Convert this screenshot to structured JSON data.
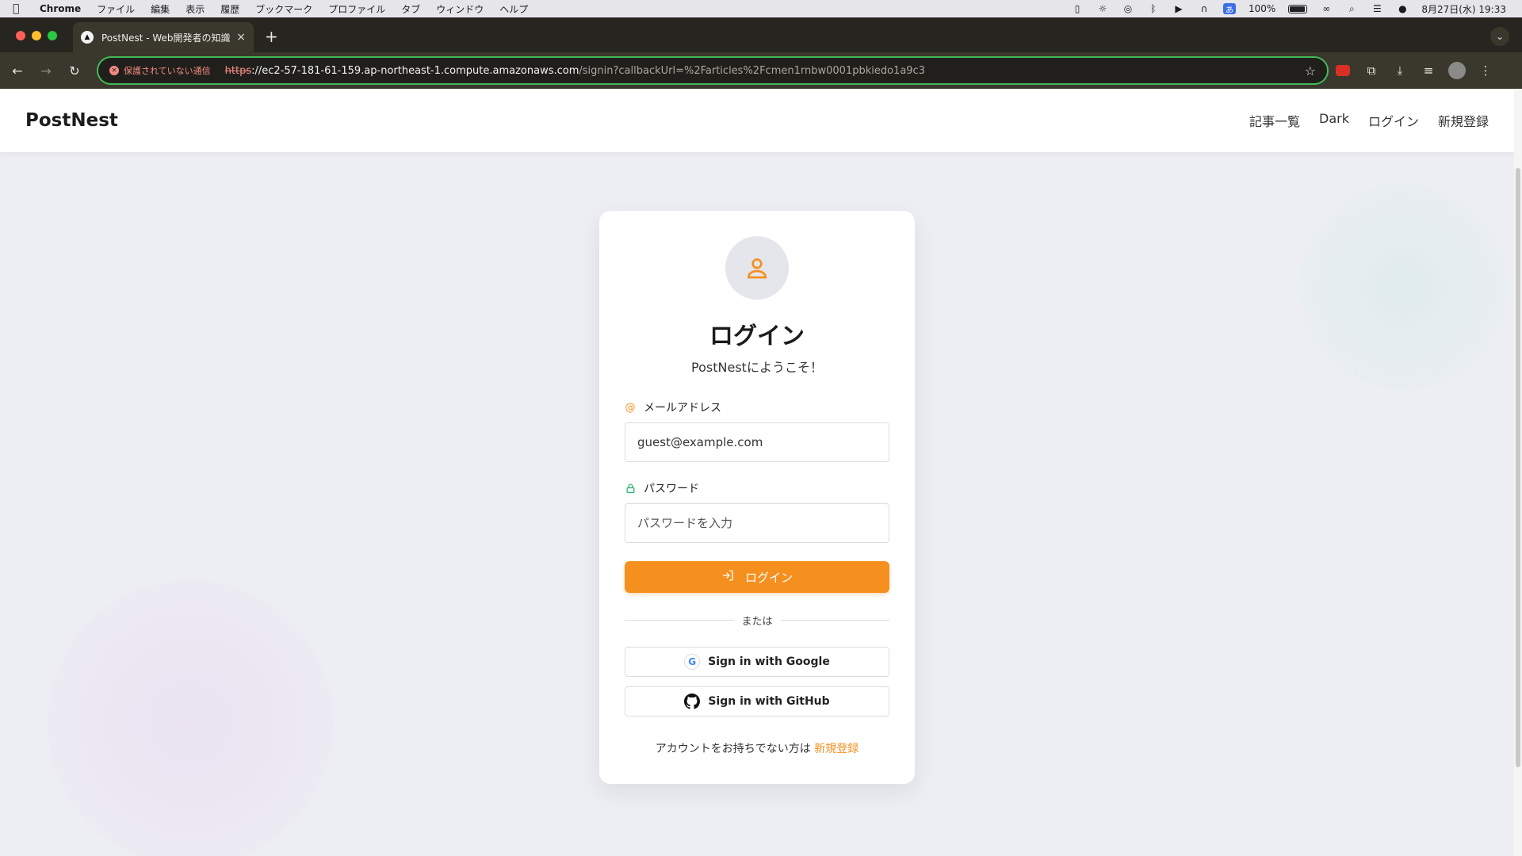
{
  "menubar": {
    "app_name": "Chrome",
    "items": [
      "ファイル",
      "編集",
      "表示",
      "履歴",
      "ブックマーク",
      "プロファイル",
      "タブ",
      "ウィンドウ",
      "ヘルプ"
    ],
    "ime": "あ",
    "battery": "100%",
    "datetime": "8月27日(水) 19:33"
  },
  "browser": {
    "tab_title": "PostNest - Web開発者の知識共",
    "security_label": "保護されていない通信",
    "url_scheme": "https",
    "url_host": "://ec2-57-181-61-159.ap-northeast-1.compute.amazonaws.com",
    "url_path": "/signin?callbackUrl=%2Farticles%2Fcmen1rnbw0001pbkiedo1a9c3"
  },
  "site": {
    "logo": "PostNest",
    "nav": [
      "記事一覧",
      "Dark",
      "ログイン",
      "新規登録"
    ]
  },
  "login": {
    "title": "ログイン",
    "subtitle": "PostNestにようこそ！",
    "email_label": "メールアドレス",
    "email_value": "guest@example.com",
    "password_label": "パスワード",
    "password_placeholder": "パスワードを入力",
    "submit_label": "ログイン",
    "divider_text": "または",
    "google_label": "Sign in with Google",
    "github_label": "Sign in with GitHub",
    "signup_prompt": "アカウントをお持ちでない方は",
    "signup_link": "新規登録"
  },
  "colors": {
    "accent": "#f5901f",
    "omnibox_border": "#43b957",
    "lock_icon": "#2fb46e"
  }
}
